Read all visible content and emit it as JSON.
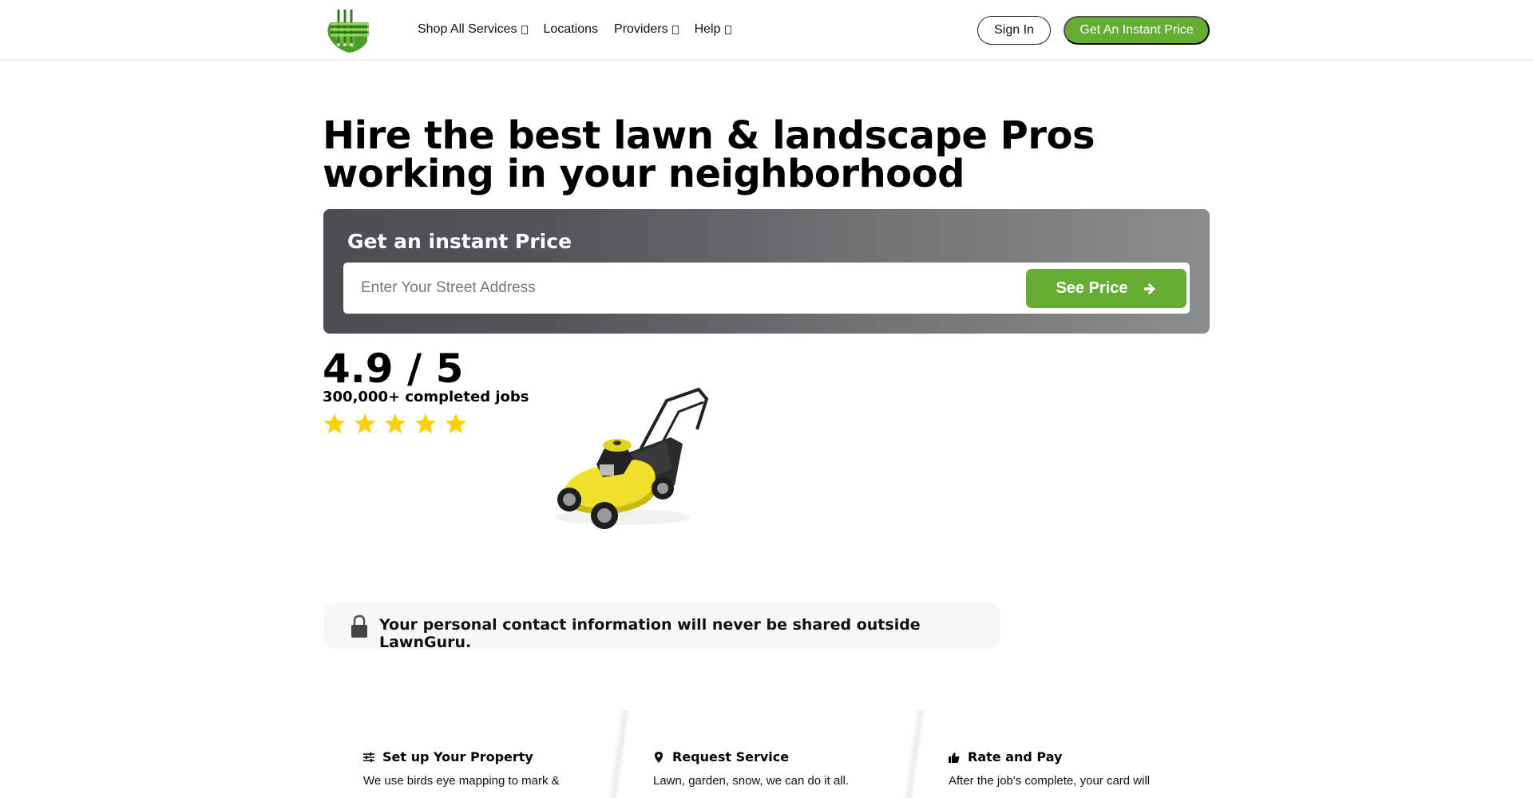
{
  "header": {
    "logo_alt": "LawnGuru logo",
    "nav": [
      {
        "label": "Shop All Services",
        "has_dropdown": true
      },
      {
        "label": "Locations",
        "has_dropdown": false
      },
      {
        "label": "Providers",
        "has_dropdown": true
      },
      {
        "label": "Help",
        "has_dropdown": true
      }
    ],
    "sign_in_label": "Sign In",
    "cta_label": "Get An Instant Price"
  },
  "hero": {
    "title_line1": "Hire the best lawn & landscape Pros",
    "title_line2": "working in your neighborhood"
  },
  "price_box": {
    "title": "Get an instant Price",
    "address_placeholder": "Enter Your Street Address",
    "address_value": "",
    "button_label": "See Price",
    "button_icon": "arrow-right-icon"
  },
  "rating": {
    "value_text": "4.9 / 5",
    "score": 4.9,
    "max": 5,
    "jobs_text": "300,000+ completed jobs",
    "stars_filled": 5,
    "star_color": "#ffd000"
  },
  "privacy": {
    "icon": "lock-icon",
    "text": "Your personal contact information will never be shared outside LawnGuru."
  },
  "steps": [
    {
      "icon": "sliders-icon",
      "title": "Set up Your Property",
      "desc": "We use birds eye mapping to mark &"
    },
    {
      "icon": "map-pin-icon",
      "title": "Request Service",
      "desc": "Lawn, garden, snow, we can do it all."
    },
    {
      "icon": "thumbs-up-icon",
      "title": "Rate and Pay",
      "desc": "After the job's complete, your card will"
    }
  ],
  "colors": {
    "brand_green": "#66ad34",
    "price_box_dark": "#4b4e52",
    "price_box_light": "#8a8d90",
    "privacy_bg": "#f6f7fa"
  }
}
